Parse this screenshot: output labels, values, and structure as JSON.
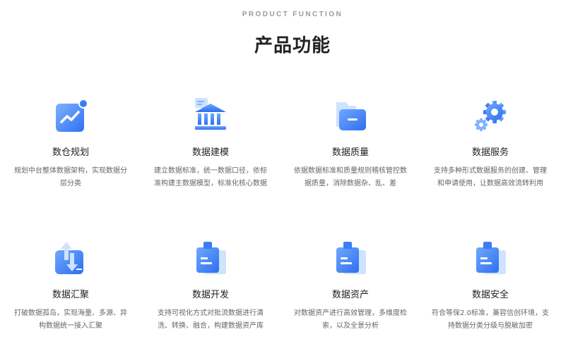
{
  "header": {
    "subtitle": "PRODUCT FUNCTION",
    "title": "产品功能"
  },
  "colors": {
    "primary": "#3d7cf2",
    "primary_light": "#7fb3ff",
    "primary_pale": "#cfe2ff"
  },
  "features": [
    {
      "icon": "trend-chart-icon",
      "name": "数仓规划",
      "desc": "规划中台整体数据架构，实现数据分层分类"
    },
    {
      "icon": "bank-building-icon",
      "name": "数据建模",
      "desc": "建立数据标准，统一数据口径，依标准构建主数据模型，标准化核心数据"
    },
    {
      "icon": "folder-icon",
      "name": "数据质量",
      "desc": "依据数据标准和质量规则稽核管控数据质量，消除数据杂、乱、差"
    },
    {
      "icon": "gears-icon",
      "name": "数据服务",
      "desc": "支持多种形式数据服务的创建、管理和申请使用，让数据高效流转利用"
    },
    {
      "icon": "up-down-arrows-icon",
      "name": "数据汇聚",
      "desc": "打破数据孤岛，实现海量、多源、异构数据统一接入汇聚"
    },
    {
      "icon": "clipboard-icon",
      "name": "数据开发",
      "desc": "支持可视化方式对批流数据进行清洗、转换、融合，构建数据资产库"
    },
    {
      "icon": "clipboard-icon",
      "name": "数据资产",
      "desc": "对数据资产进行高效管理，多维度检索，以及全景分析"
    },
    {
      "icon": "clipboard-icon",
      "name": "数据安全",
      "desc": "符合等保2.0标准，兼容信创环境，支持数据分类分级与脱敏加密"
    }
  ]
}
